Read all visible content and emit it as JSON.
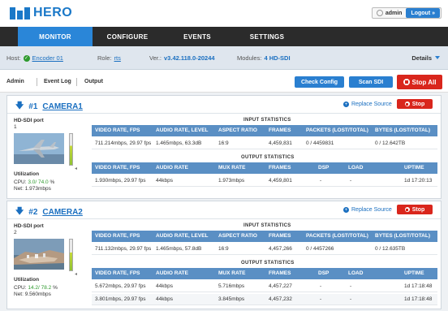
{
  "header": {
    "logo_text": "HERO",
    "user": "admin",
    "logout_label": "Logout »"
  },
  "nav": {
    "tabs": [
      {
        "label": "MONITOR",
        "active": true
      },
      {
        "label": "CONFIGURE",
        "active": false
      },
      {
        "label": "EVENTS",
        "active": false
      },
      {
        "label": "SETTINGS",
        "active": false
      }
    ]
  },
  "hostbar": {
    "host_label": "Host:",
    "host_value": "Encoder 01",
    "role_label": "Role:",
    "role_value": "rts",
    "ver_label": "Ver.:",
    "ver_value": "v3.42.118.0-20244",
    "modules_label": "Modules:",
    "modules_value": "4 HD-SDI",
    "details_label": "Details"
  },
  "subbar": {
    "links": [
      "Admin",
      "Event Log",
      "Output"
    ],
    "check_config": "Check Config",
    "scan_sdi": "Scan SDI",
    "stop_all": "Stop All"
  },
  "input_columns": [
    "VIDEO RATE, FPS",
    "AUDIO RATE, LEVEL",
    "ASPECT RATIO",
    "FRAMES",
    "PACKETS (LOST/TOTAL)",
    "BYTES (LOST/TOTAL)"
  ],
  "output_columns": [
    "VIDEO RATE, FPS",
    "AUDIO RATE",
    "MUX RATE",
    "FRAMES",
    "DSP",
    "LOAD",
    "UPTIME"
  ],
  "labels": {
    "input_statistics": "INPUT STATISTICS",
    "output_statistics": "OUTPUT STATISTICS",
    "hd_sdi_port": "HD-SDI port",
    "utilization": "Utilization",
    "cpu": "CPU:",
    "net": "Net:",
    "replace_source": "Replace Source",
    "stop": "Stop"
  },
  "cameras": [
    {
      "number": "#1",
      "name": "CAMERA1",
      "port": "1",
      "cpu_value": "3.0",
      "cpu_total": "/ 74.0",
      "cpu_unit": "%",
      "net_value": "1.973mbps",
      "input_row": [
        "711.214mbps, 29.97 fps",
        "1.465mbps, 63.3dB",
        "16:9",
        "4,459,831",
        "0 / 4459831",
        "0 / 12.642TB"
      ],
      "output_rows": [
        [
          "1.930mbps, 29.97 fps",
          "44kbps",
          "1.973mbps",
          "4,459,801",
          "-",
          "-",
          "1d 17:20:13"
        ]
      ]
    },
    {
      "number": "#2",
      "name": "CAMERA2",
      "port": "2",
      "cpu_value": "14.2",
      "cpu_total": "/ 78.2",
      "cpu_unit": "%",
      "net_value": "9.560mbps",
      "input_row": [
        "711.132mbps, 29.97 fps",
        "1.465mbps, 57.8dB",
        "16:9",
        "4,457,266",
        "0 / 4457266",
        "0 / 12.635TB"
      ],
      "output_rows": [
        [
          "5.672mbps, 29.97 fps",
          "44kbps",
          "5.716mbps",
          "4,457,227",
          "-",
          "-",
          "1d 17:18:48"
        ],
        [
          "3.801mbps, 29.97 fps",
          "44kbps",
          "3.845mbps",
          "4,457,232",
          "-",
          "-",
          "1d 17:18:48"
        ]
      ]
    }
  ]
}
